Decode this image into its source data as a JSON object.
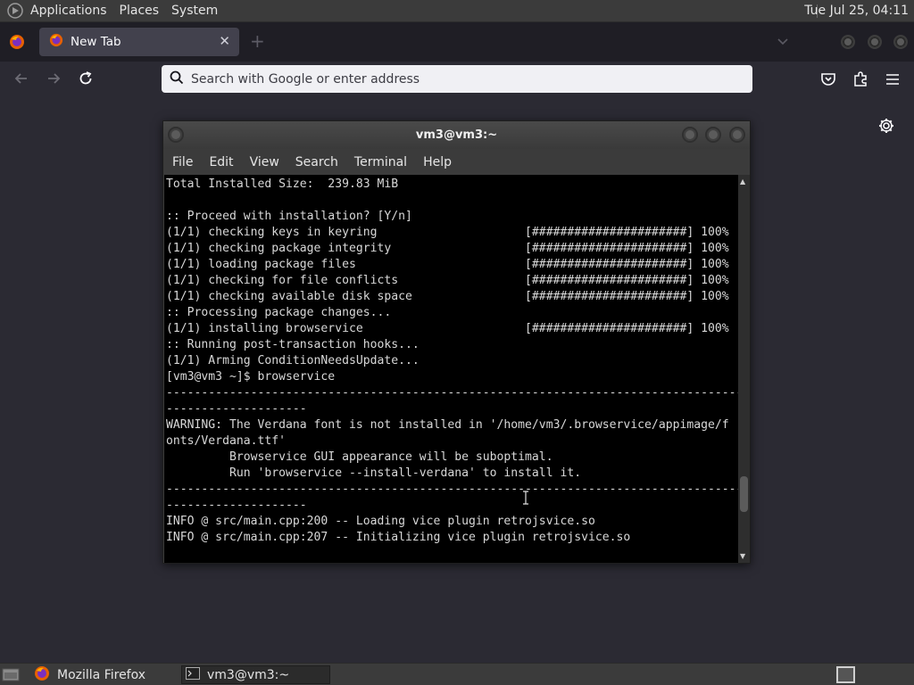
{
  "top_panel": {
    "menus": [
      "Applications",
      "Places",
      "System"
    ],
    "clock": "Tue Jul 25, 04:11"
  },
  "browser": {
    "tab": {
      "title": "New Tab",
      "close": "✕"
    },
    "new_tab": "+",
    "url_bar": {
      "placeholder": "Search with Google or enter address"
    }
  },
  "terminal": {
    "title": "vm3@vm3:~",
    "menu": [
      "File",
      "Edit",
      "View",
      "Search",
      "Terminal",
      "Help"
    ],
    "lines": [
      "Total Installed Size:  239.83 MiB",
      "",
      ":: Proceed with installation? [Y/n]",
      "(1/1) checking keys in keyring                     [######################] 100%",
      "(1/1) checking package integrity                   [######################] 100%",
      "(1/1) loading package files                        [######################] 100%",
      "(1/1) checking for file conflicts                  [######################] 100%",
      "(1/1) checking available disk space                [######################] 100%",
      ":: Processing package changes...",
      "(1/1) installing browservice                       [######################] 100%",
      ":: Running post-transaction hooks...",
      "(1/1) Arming ConditionNeedsUpdate...",
      "[vm3@vm3 ~]$ browservice",
      "----------------------------------------------------------------------------------------------------",
      "--------------------",
      "WARNING: The Verdana font is not installed in '/home/vm3/.browservice/appimage/f",
      "onts/Verdana.ttf'",
      "         Browservice GUI appearance will be suboptimal.",
      "         Run 'browservice --install-verdana' to install it.",
      "----------------------------------------------------------------------------------------------------",
      "--------------------",
      "INFO @ src/main.cpp:200 -- Loading vice plugin retrojsvice.so",
      "INFO @ src/main.cpp:207 -- Initializing vice plugin retrojsvice.so"
    ]
  },
  "taskbar": {
    "tasks": [
      {
        "label": "Mozilla Firefox",
        "active": false
      },
      {
        "label": "vm3@vm3:~",
        "active": true
      }
    ]
  },
  "colors": {
    "panel": "#3b3b3b",
    "browser_chrome": "#2b2a33",
    "tab_strip": "#1f1e25",
    "terminal_bg": "#000000",
    "terminal_fg": "#d8d8d8"
  }
}
